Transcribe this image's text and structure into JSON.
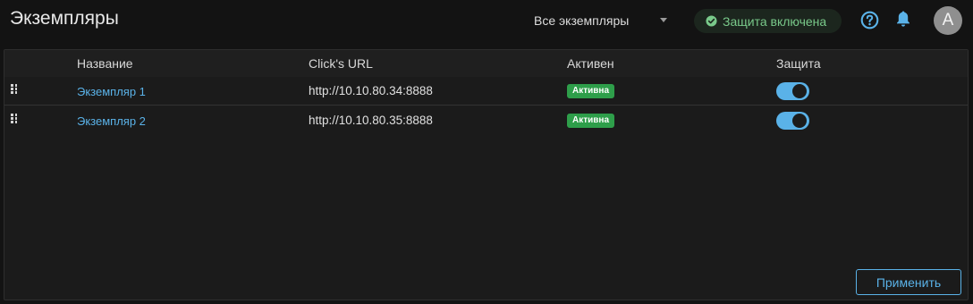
{
  "header": {
    "title": "Экземпляры",
    "instance_filter": {
      "selected": "Все экземпляры"
    },
    "protection_status": {
      "label": "Защита включена",
      "icon": "check-circle-icon",
      "color": "#79c98a"
    },
    "help_icon": "help-circle-icon",
    "bell_icon": "bell-icon",
    "avatar_initial": "A"
  },
  "table": {
    "columns": [
      "Название",
      "Click's URL",
      "Активен",
      "Защита"
    ],
    "rows": [
      {
        "name": "Экземпляр 1",
        "url": "http://10.10.80.34:8888",
        "active": "Активна",
        "protection_on": true
      },
      {
        "name": "Экземпляр 2",
        "url": "http://10.10.80.35:8888",
        "active": "Активна",
        "protection_on": true
      }
    ]
  },
  "footer": {
    "apply_label": "Применить"
  },
  "colors": {
    "accent": "#5ab2e8",
    "success": "#2e9e4a",
    "background": "#131313"
  }
}
